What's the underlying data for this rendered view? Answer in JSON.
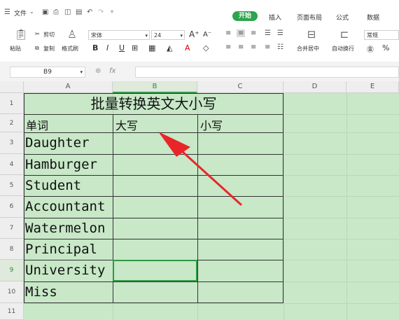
{
  "menubar": {
    "file_label": "文件",
    "tabs": [
      "开始",
      "插入",
      "页面布局",
      "公式",
      "数据"
    ]
  },
  "ribbon": {
    "paste": "粘贴",
    "cut": "剪切",
    "copy": "复制",
    "format_painter": "格式刷",
    "font_name": "宋体",
    "font_size": "24",
    "bold": "B",
    "italic": "I",
    "underline": "U",
    "merge_center": "合并居中",
    "wrap_text": "自动换行",
    "number_format": "常规",
    "percent": "%"
  },
  "formula_bar": {
    "name_box": "B9",
    "fx": "fx",
    "formula": ""
  },
  "sheet": {
    "columns": [
      "A",
      "B",
      "C",
      "D",
      "E"
    ],
    "rows": [
      "1",
      "2",
      "3",
      "4",
      "5",
      "6",
      "7",
      "8",
      "9",
      "10",
      "11"
    ],
    "title": "批量转换英文大小写",
    "header_word": "单词",
    "header_upper": "大写",
    "header_lower": "小写",
    "words": [
      "Daughter",
      "Hamburger",
      "Student",
      "Accountant",
      "Watermelon",
      "Principal",
      "University",
      "Miss"
    ],
    "selected_cell": "B9"
  },
  "colors": {
    "accent": "#2da44e",
    "cell_fill": "#c8e8c8",
    "arrow": "#e8262a"
  }
}
